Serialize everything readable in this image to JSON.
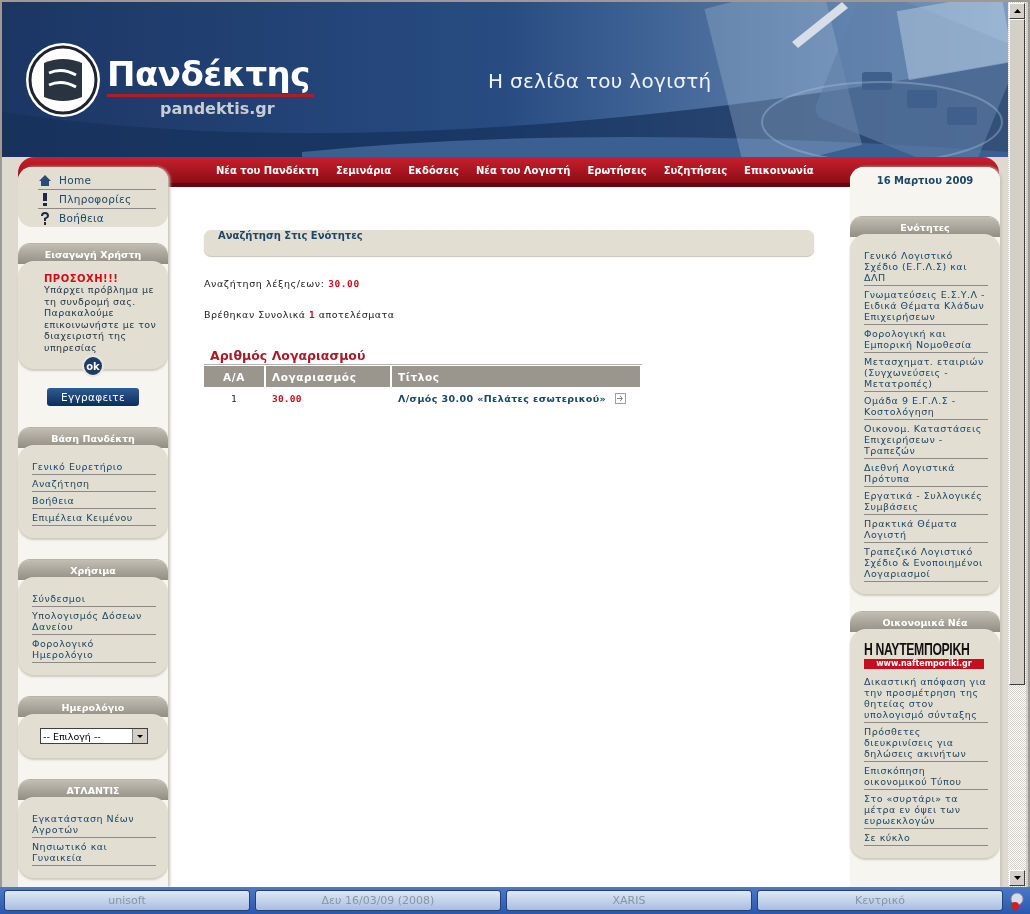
{
  "header": {
    "brand": "Πανδέκτης",
    "domain": "pandektis.gr",
    "tagline": "Η σελίδα του λογιστή"
  },
  "nav": [
    "Νέα του Πανδέκτη",
    "Σεμινάρια",
    "Εκδόσεις",
    "Νέα του Λογιστή",
    "Ερωτήσεις",
    "Συζητήσεις",
    "Επικοινωνία"
  ],
  "quick_links": [
    {
      "label": "Home",
      "kind": "home"
    },
    {
      "label": "Πληροφορίες",
      "kind": "info"
    },
    {
      "label": "Βοήθεια",
      "kind": "help"
    }
  ],
  "left_panels": [
    {
      "kind": "login",
      "title": "Εισαγωγή Χρήστη",
      "warning_title": "ΠΡΟΣΟΧΗ!!!",
      "message": "Υπάρχει πρόβλημα με τη συνδρομή σας. Παρακαλούμε επικοινωνήστε με τον διαχειριστή της υπηρεσίας",
      "ok": "ok",
      "register": "Εγγραφειτε"
    },
    {
      "kind": "links",
      "title": "Βάση Πανδέκτη",
      "links": [
        "Γενικό Ευρετήριο",
        "Αναζήτηση",
        "Βοήθεια",
        "Επιμέλεια Κειμένου"
      ]
    },
    {
      "kind": "links",
      "title": "Χρήσιμα",
      "links": [
        "Σύνδεσμοι",
        "Υπολογισμός Δόσεων Δανείου",
        "Φορολογικό Ημερολόγιο"
      ]
    },
    {
      "kind": "select",
      "title": "Ημερολόγιο",
      "select": "-- Επιλογή --"
    },
    {
      "kind": "links",
      "title": "ΑΤΛΑΝΤΙΣ",
      "links": [
        "Εγκατάσταση Νέων Αγροτών",
        "Νησιωτικό και Γυναικεία"
      ]
    }
  ],
  "main": {
    "section_title": "Αναζήτηση Στις Ενότητες",
    "query_label": "Αναζήτηση λέξης/εων:",
    "query": "30.00",
    "results": "Βρέθηκαν Συνολικά **1** αποτελέσματα",
    "table": {
      "title": "Αριθμός Λογαριασμού",
      "columns": [
        "Α/Α",
        "Λογαριασμός",
        "Τίτλος"
      ],
      "rows": [
        {
          "index": "1",
          "account": "30.00",
          "title": "Λ/σμός 30.00 «Πελάτες εσωτερικού»"
        }
      ]
    }
  },
  "right": {
    "date": "16 Μαρτιου 2009",
    "panels": [
      {
        "kind": "links",
        "title": "Ενότητες",
        "links": [
          "Γενικό Λογιστικό Σχέδιο (Ε.Γ.Λ.Σ) και ΔΛΠ",
          "Γνωματεύσεις Ε.Σ.Υ.Λ - Ειδικά Θέματα Κλάδων Επιχειρήσεων",
          "Φορολογική και Εμπορική Νομοθεσία",
          "Μετασχηματ. εταιριών (Συγχωνεύσεις - Μετατροπές)",
          "Ομάδα 9 Ε.Γ.Λ.Σ - Κοστολόγηση",
          "Οικονομ. Καταστάσεις Επιχειρήσεων - Τραπεζών",
          "Διεθνή Λογιστικά Πρότυπα",
          "Εργατικά - Συλλογικές Συμβάσεις",
          "Πρακτικά Θέματα Λογιστή",
          "Τραπεζικό Λογιστικό Σχέδιο & Ενοποιημένοι Λογαριασμοί"
        ]
      },
      {
        "kind": "news",
        "title": "Οικονομικά Νέα",
        "source": "Η ΝΑΥΤΕΜΠΟΡΙΚΗ",
        "source_url": "www.naftemporiki.gr",
        "links": [
          "Δικαστική απόφαση για την προσμέτρηση της θητείας στον υπολογισμό σύνταξης",
          "Πρόσθετες διευκρινίσεις για δηλώσεις ακινήτων",
          "Επισκόπηση οικονομικού Τύπου",
          "Στο «συρτάρι» τα μέτρα εν όψει των ευρωεκλογών",
          "Σε κύκλο"
        ]
      }
    ]
  },
  "taskbar": [
    "unisoft",
    "Δευ 16/03/09 (2008)",
    "XARIS",
    "Κεντρικό"
  ]
}
